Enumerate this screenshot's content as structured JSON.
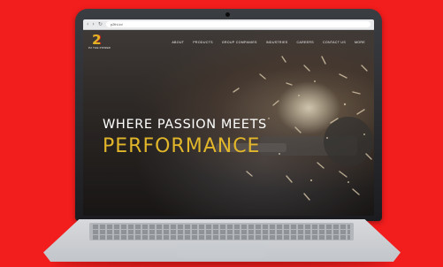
{
  "browser": {
    "back_icon": "back-arrow-icon",
    "forward_icon": "forward-arrow-icon",
    "reload_icon": "reload-icon",
    "url": "p2thi.in/"
  },
  "site": {
    "logo_mark": "2",
    "logo_text": "P2 THE POWER",
    "nav": [
      {
        "label": "ABOUT"
      },
      {
        "label": "PRODUCTS"
      },
      {
        "label": "GROUP COMPANIES"
      },
      {
        "label": "INDUSTRIES"
      },
      {
        "label": "CAREERS"
      },
      {
        "label": "CONTACT US"
      },
      {
        "label": "MORE"
      }
    ]
  },
  "hero": {
    "line1": "WHERE PASSION MEETS",
    "line2": "PERFORMANCE"
  },
  "colors": {
    "background": "#f21d1d",
    "accent_gold": "#e2b62a"
  }
}
